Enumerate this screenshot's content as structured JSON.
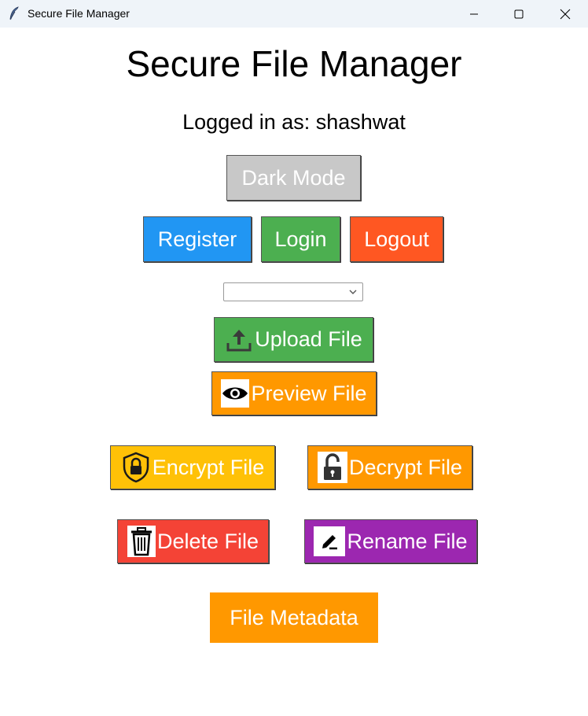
{
  "window": {
    "title": "Secure File Manager",
    "icons": {
      "app": "feather-icon",
      "minimize": "minimize-icon",
      "maximize": "maximize-icon",
      "close": "close-icon"
    }
  },
  "main": {
    "heading": "Secure File Manager",
    "logged_in_text": "Logged in as: shashwat",
    "buttons": {
      "dark_mode": "Dark Mode",
      "register": "Register",
      "login": "Login",
      "logout": "Logout",
      "upload": "Upload File",
      "preview": "Preview File",
      "encrypt": "Encrypt File",
      "decrypt": "Decrypt File",
      "delete": "Delete File",
      "rename": "Rename File",
      "metadata": "File Metadata"
    },
    "file_select": {
      "value": ""
    },
    "icons": {
      "upload": "upload-icon",
      "preview": "eye-icon",
      "encrypt": "shield-lock-icon",
      "decrypt": "unlock-icon",
      "delete": "trash-icon",
      "rename": "pencil-icon"
    }
  },
  "colors": {
    "dark_mode": "#c8c8c8",
    "register": "#2196f3",
    "login": "#4caf50",
    "logout": "#ff5722",
    "upload": "#4caf50",
    "preview": "#ff9800",
    "encrypt": "#ffc107",
    "decrypt": "#ff9800",
    "delete": "#f44336",
    "rename": "#9c27b0",
    "metadata": "#ff9800"
  }
}
